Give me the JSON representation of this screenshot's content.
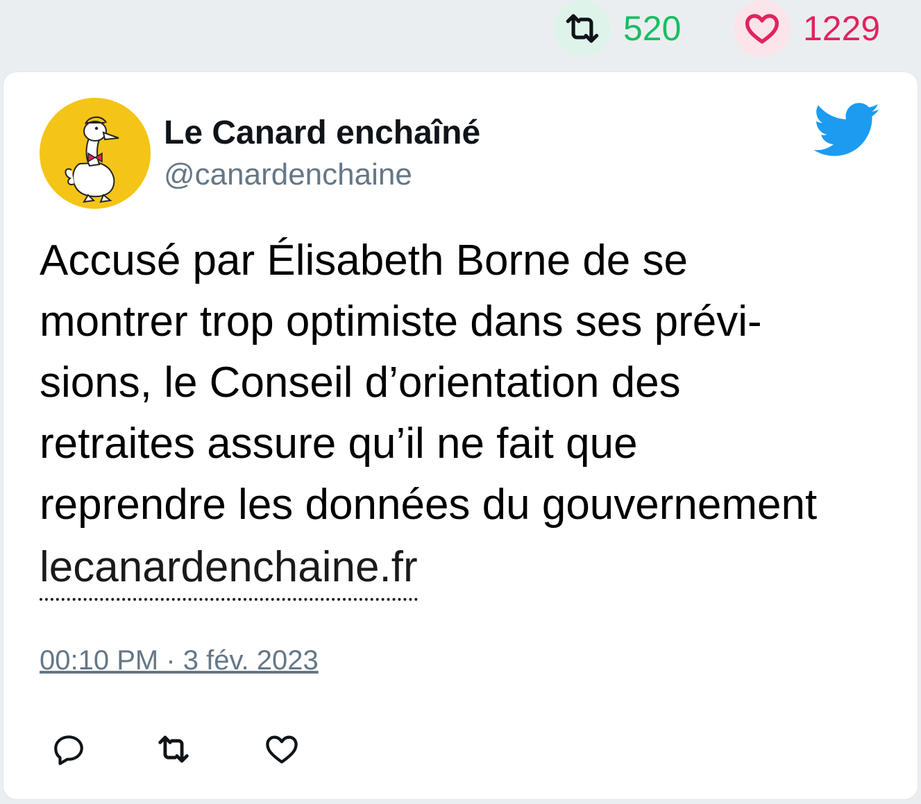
{
  "stats": {
    "retweet_count": "520",
    "like_count": "1229",
    "retweet_color": "#17bf63",
    "like_color": "#e0245e"
  },
  "tweet": {
    "author_name": "Le Canard enchaîné",
    "author_handle": "@canardenchaine",
    "text_lines": [
      "Accusé par Élisabeth Borne de se",
      "montrer trop optimiste dans ses prévi-",
      "sions, le Conseil d’orientation des",
      "retraites assure qu’il ne fait que",
      "reprendre les données du gouvernement"
    ],
    "link_text": "lecanardenchaine.fr",
    "timestamp": "00:10 PM · 3 fév. 2023"
  },
  "icons": {
    "retweet": "retweet-icon",
    "like": "heart-icon",
    "reply": "reply-icon",
    "brand": "twitter-bird-icon",
    "avatar": "canard-duck-logo"
  },
  "colors": {
    "brand": "#1d9bf0",
    "avatar_bg": "#f4c417",
    "secondary_text": "#657786"
  }
}
